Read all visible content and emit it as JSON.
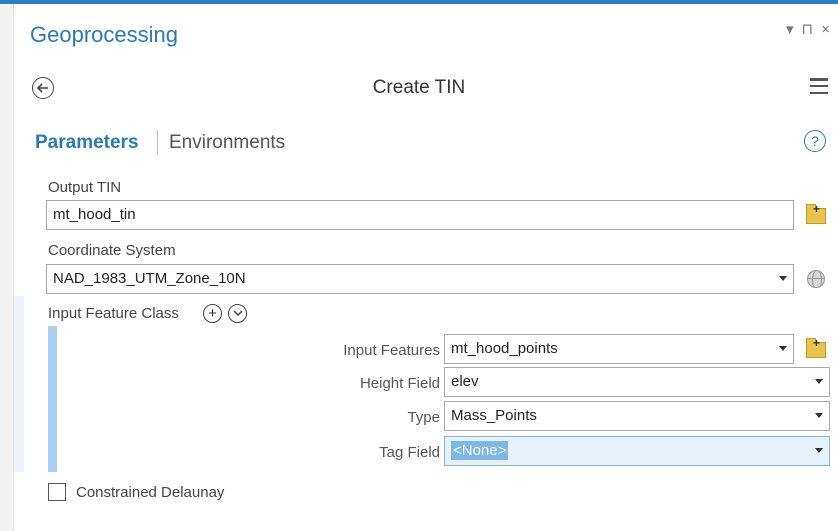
{
  "pane": {
    "title": "Geoprocessing",
    "ctrl_pin": "▾",
    "ctrl_auto": "⊓",
    "ctrl_close": "×"
  },
  "tool": {
    "title": "Create TIN"
  },
  "tabs": {
    "parameters": "Parameters",
    "environments": "Environments"
  },
  "help": {
    "glyph": "?"
  },
  "output_tin": {
    "label": "Output TIN",
    "value": "mt_hood_tin"
  },
  "coord_system": {
    "label": "Coordinate System",
    "value": "NAD_1983_UTM_Zone_10N"
  },
  "input_feature_class": {
    "label": "Input Feature Class",
    "add_glyph": "+",
    "expand_glyph": "⌄",
    "rows": {
      "input_features": {
        "label": "Input Features",
        "value": "mt_hood_points"
      },
      "height_field": {
        "label": "Height Field",
        "value": "elev"
      },
      "type": {
        "label": "Type",
        "value": "Mass_Points"
      },
      "tag_field": {
        "label": "Tag Field",
        "value": "<None>"
      }
    }
  },
  "constrained_delaunay": {
    "label": "Constrained Delaunay",
    "checked": false
  },
  "colors": {
    "accent": "#2a7ab8",
    "group_bar": "#a9cff0",
    "folder": "#e8c44e"
  }
}
